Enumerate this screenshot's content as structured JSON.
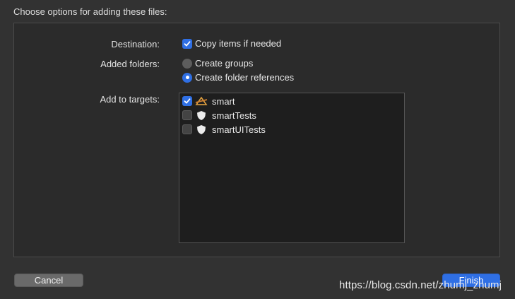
{
  "dialog": {
    "heading": "Choose options for adding these files:"
  },
  "destination": {
    "label": "Destination:",
    "copy_items_label": "Copy items if needed",
    "copy_items_checked": true
  },
  "added_folders": {
    "label": "Added folders:",
    "options": [
      {
        "label": "Create groups",
        "selected": false
      },
      {
        "label": "Create folder references",
        "selected": true
      }
    ]
  },
  "targets": {
    "label": "Add to targets:",
    "items": [
      {
        "name": "smart",
        "checked": true,
        "icon": "app-target-icon"
      },
      {
        "name": "smartTests",
        "checked": false,
        "icon": "test-shield-icon"
      },
      {
        "name": "smartUITests",
        "checked": false,
        "icon": "test-shield-icon"
      }
    ]
  },
  "buttons": {
    "cancel": "Cancel",
    "finish": "Finish"
  },
  "watermark": "https://blog.csdn.net/zhumj_zhumj",
  "colors": {
    "accent": "#2f6fe4",
    "background": "#323232",
    "panel": "#2b2b2b",
    "list": "#1e1e1e"
  }
}
